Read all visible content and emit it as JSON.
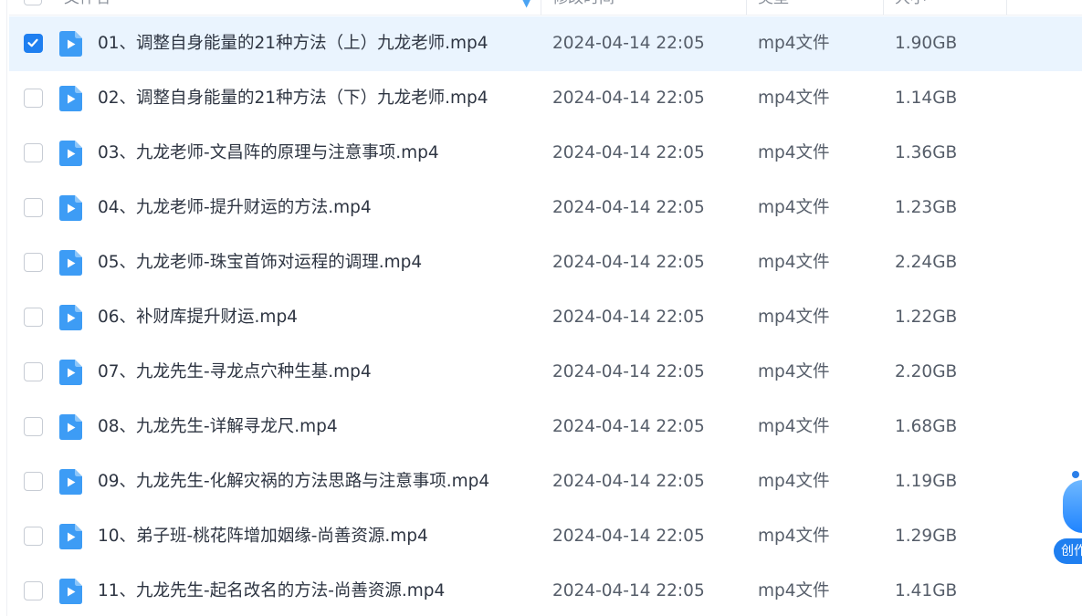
{
  "header": {
    "name_label": "文件名",
    "time_label": "修改时间",
    "type_label": "类型",
    "size_label": "大小"
  },
  "colors": {
    "accent": "#1f7ff0",
    "selected_row_bg": "#eaf4fe",
    "video_icon": "#3d9cf5"
  },
  "files": [
    {
      "name": "01、调整自身能量的21种方法（上）九龙老师.mp4",
      "modified": "2024-04-14 22:05",
      "type": "mp4文件",
      "size": "1.90GB",
      "selected": true,
      "icon": "video-file-icon"
    },
    {
      "name": "02、调整自身能量的21种方法（下）九龙老师.mp4",
      "modified": "2024-04-14 22:05",
      "type": "mp4文件",
      "size": "1.14GB",
      "selected": false,
      "icon": "video-file-icon"
    },
    {
      "name": "03、九龙老师-文昌阵的原理与注意事项.mp4",
      "modified": "2024-04-14 22:05",
      "type": "mp4文件",
      "size": "1.36GB",
      "selected": false,
      "icon": "video-file-icon"
    },
    {
      "name": "04、九龙老师-提升财运的方法.mp4",
      "modified": "2024-04-14 22:05",
      "type": "mp4文件",
      "size": "1.23GB",
      "selected": false,
      "icon": "video-file-icon"
    },
    {
      "name": "05、九龙老师-珠宝首饰对运程的调理.mp4",
      "modified": "2024-04-14 22:05",
      "type": "mp4文件",
      "size": "2.24GB",
      "selected": false,
      "icon": "video-file-icon"
    },
    {
      "name": "06、补财库提升财运.mp4",
      "modified": "2024-04-14 22:05",
      "type": "mp4文件",
      "size": "1.22GB",
      "selected": false,
      "icon": "video-file-icon"
    },
    {
      "name": "07、九龙先生-寻龙点穴种生基.mp4",
      "modified": "2024-04-14 22:05",
      "type": "mp4文件",
      "size": "2.20GB",
      "selected": false,
      "icon": "video-file-icon"
    },
    {
      "name": "08、九龙先生-详解寻龙尺.mp4",
      "modified": "2024-04-14 22:05",
      "type": "mp4文件",
      "size": "1.68GB",
      "selected": false,
      "icon": "video-file-icon"
    },
    {
      "name": "09、九龙先生-化解灾祸的方法思路与注意事项.mp4",
      "modified": "2024-04-14 22:05",
      "type": "mp4文件",
      "size": "1.19GB",
      "selected": false,
      "icon": "video-file-icon"
    },
    {
      "name": "10、弟子班-桃花阵增加姻缘-尚善资源.mp4",
      "modified": "2024-04-14 22:05",
      "type": "mp4文件",
      "size": "1.29GB",
      "selected": false,
      "icon": "video-file-icon"
    },
    {
      "name": "11、九龙先生-起名改名的方法-尚善资源.mp4",
      "modified": "2024-04-14 22:05",
      "type": "mp4文件",
      "size": "1.41GB",
      "selected": false,
      "icon": "video-file-icon"
    }
  ],
  "float_widget": {
    "label": "创作"
  }
}
